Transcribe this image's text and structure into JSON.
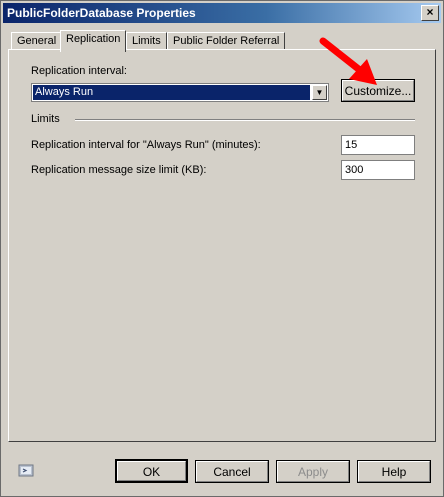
{
  "window": {
    "title": "PublicFolderDatabase Properties",
    "close_label": "×"
  },
  "tabs": [
    {
      "label": "General"
    },
    {
      "label": "Replication"
    },
    {
      "label": "Limits"
    },
    {
      "label": "Public Folder Referral"
    }
  ],
  "replication": {
    "interval_label": "Replication interval:",
    "interval_value": "Always Run",
    "customize_label": "Customize..."
  },
  "limits": {
    "section_label": "Limits",
    "always_run_label": "Replication interval for \"Always Run\" (minutes):",
    "always_run_value": "15",
    "message_size_label": "Replication message size limit (KB):",
    "message_size_value": "300"
  },
  "buttons": {
    "ok": "OK",
    "cancel": "Cancel",
    "apply": "Apply",
    "help": "Help"
  },
  "colors": {
    "accent_arrow": "#ff0000",
    "selection": "#0a246a"
  }
}
